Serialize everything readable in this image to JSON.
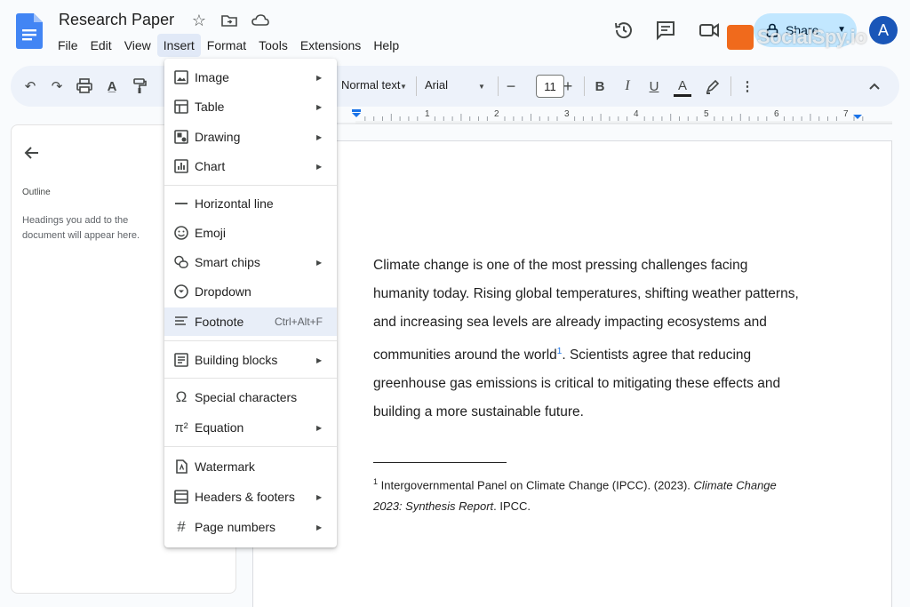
{
  "header": {
    "doc_title": "Research Paper",
    "menus": [
      "File",
      "Edit",
      "View",
      "Insert",
      "Format",
      "Tools",
      "Extensions",
      "Help"
    ],
    "active_menu": "Insert",
    "share_label": "Share",
    "avatar_letter": "A",
    "watermark": "SocialSpy.io"
  },
  "toolbar": {
    "style": "Normal text",
    "font": "Arial",
    "font_size": "11"
  },
  "ruler": {
    "numbers": [
      "1",
      "2",
      "3",
      "4",
      "5",
      "6",
      "7"
    ]
  },
  "outline": {
    "title": "Outline",
    "hint": "Headings you add to the document will appear here."
  },
  "insert_menu": {
    "items": [
      {
        "label": "Image",
        "icon": "image-icon",
        "submenu": true
      },
      {
        "label": "Table",
        "icon": "table-icon",
        "submenu": true
      },
      {
        "label": "Drawing",
        "icon": "drawing-icon",
        "submenu": true
      },
      {
        "label": "Chart",
        "icon": "chart-icon",
        "submenu": true
      },
      {
        "label": "Horizontal line",
        "icon": "horizontal-line-icon",
        "submenu": false
      },
      {
        "label": "Emoji",
        "icon": "emoji-icon",
        "submenu": false
      },
      {
        "label": "Smart chips",
        "icon": "smart-chips-icon",
        "submenu": true
      },
      {
        "label": "Dropdown",
        "icon": "dropdown-icon",
        "submenu": false
      },
      {
        "label": "Footnote",
        "icon": "footnote-icon",
        "submenu": false,
        "shortcut": "Ctrl+Alt+F"
      },
      {
        "label": "Building blocks",
        "icon": "building-blocks-icon",
        "submenu": true
      },
      {
        "label": "Special characters",
        "icon": "omega-icon",
        "submenu": false
      },
      {
        "label": "Equation",
        "icon": "pi-icon",
        "submenu": true
      },
      {
        "label": "Watermark",
        "icon": "watermark-icon",
        "submenu": false
      },
      {
        "label": "Headers & footers",
        "icon": "headers-footers-icon",
        "submenu": true
      },
      {
        "label": "Page numbers",
        "icon": "hash-icon",
        "submenu": true
      }
    ],
    "highlighted": "Footnote"
  },
  "document": {
    "para_before": "Climate change is one of the most pressing challenges facing humanity today. Rising global temperatures, shifting weather patterns, and increasing sea levels are already impacting ecosystems and communities around the world",
    "para_ref": "1",
    "para_after": ". Scientists agree that reducing greenhouse gas emissions is critical to mitigating these effects and building a more sustainable future.",
    "footnote_num": "1",
    "footnote_text": "Intergovernmental Panel on Climate Change (IPCC). (2023). ",
    "footnote_italic": "Climate Change 2023: Synthesis Report",
    "footnote_end": ". IPCC."
  }
}
